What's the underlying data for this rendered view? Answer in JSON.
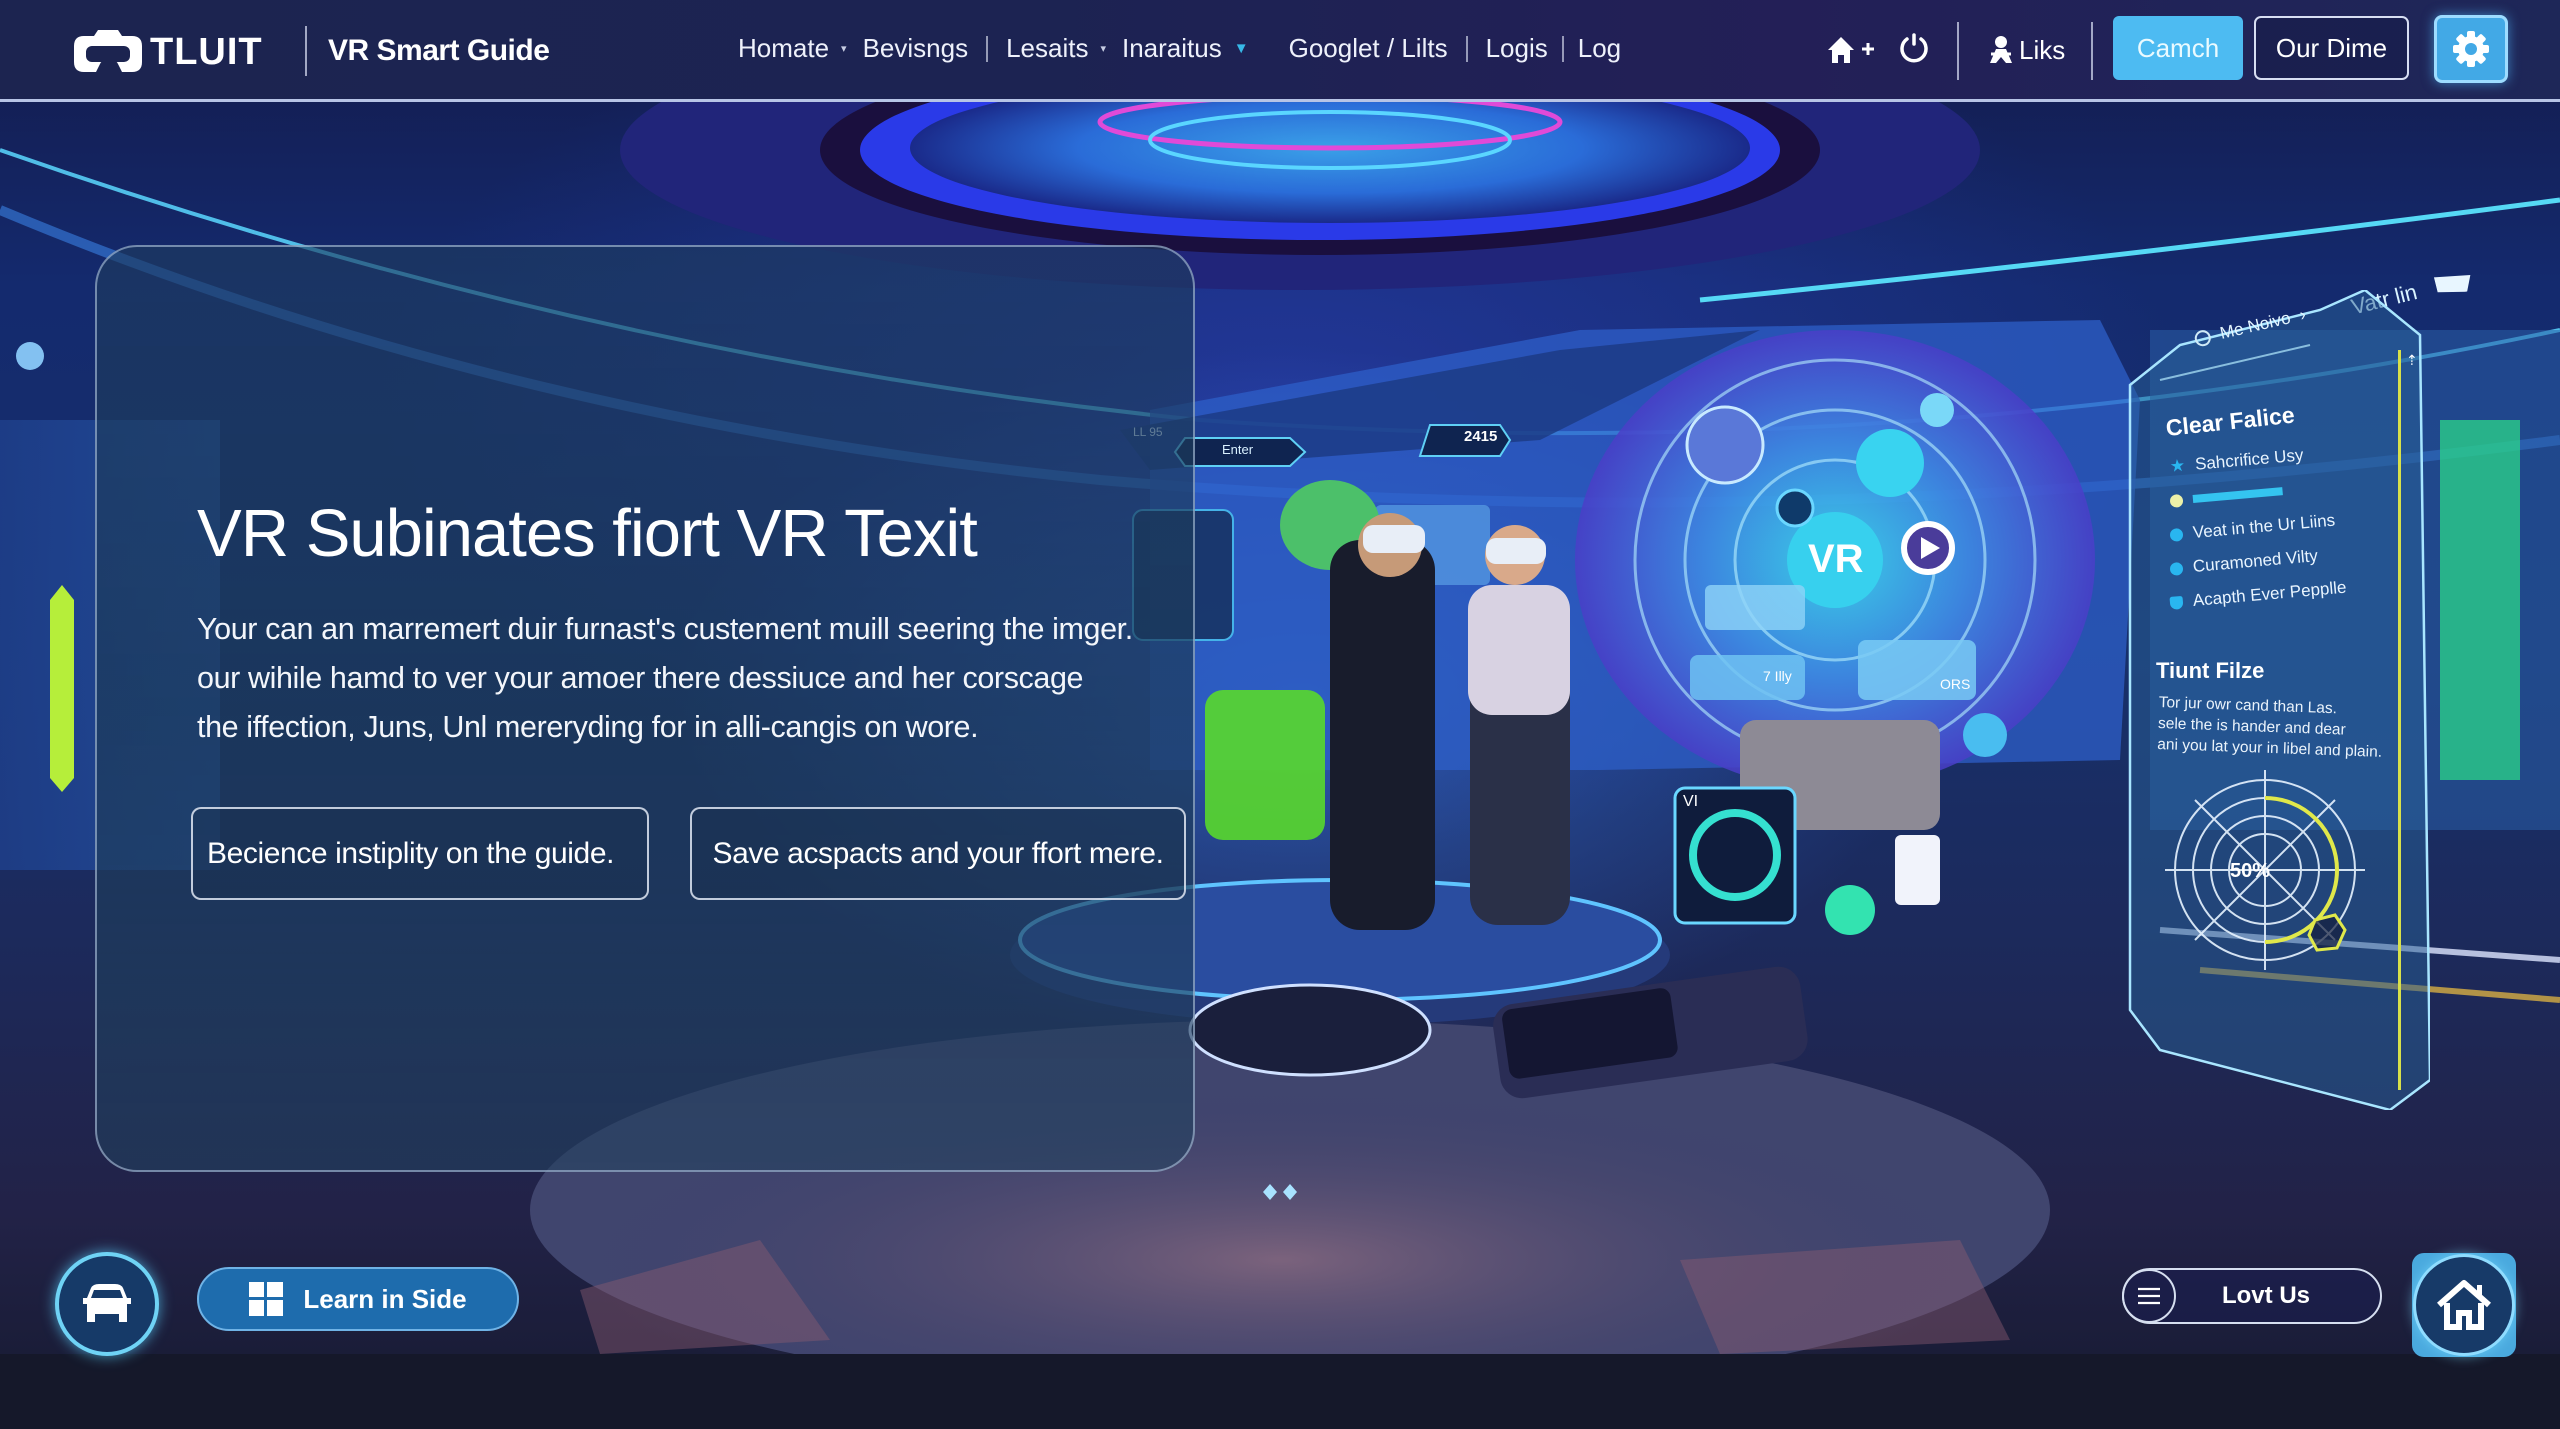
{
  "header": {
    "logo_text": "TLUIT",
    "app_title": "VR Smart Guide",
    "nav": [
      {
        "label": "Homate",
        "has_caret": true
      },
      {
        "label": "Bevisngs",
        "has_caret": false
      },
      {
        "label": "Lesaits",
        "has_caret": true
      },
      {
        "label": "Inaraitus",
        "has_caret": true,
        "caret_accent": true
      },
      {
        "label": "Googlet / Lilts",
        "has_caret": false
      },
      {
        "label": "Logis",
        "has_caret": false
      },
      {
        "label": "Log",
        "has_caret": false
      }
    ],
    "home_add_icon": "home-plus-icon",
    "power_icon": "power-icon",
    "liks_label": "Liks",
    "liks_icon": "person-icon",
    "camch_label": "Camch",
    "our_dime_label": "Our Dime",
    "settings_icon": "gear-icon",
    "colors": {
      "accent": "#4dbbf2",
      "nav_bg": "#1c2450"
    }
  },
  "hero": {
    "title": "VR Subinates fiort VR Texit",
    "body_lines": [
      "Your can an marremert duir furnast's custement muill seering the imger.",
      "our wihile hamd to ver your amoer there dessiuce and her corscage",
      "the iffection, Juns, Unl mereryding for in alli-cangis on wore."
    ],
    "button_1": "Becience instiplity on the guide.",
    "button_2": "Save acspacts and your ffort mere."
  },
  "scene": {
    "hud_tag_1": "Enter",
    "hud_tag_2": "LL 95",
    "score_value": "2415",
    "center_badge": "VR",
    "chip_1": "7 Illy",
    "chip_2": "ORS",
    "device_label": "VI"
  },
  "hud_panel": {
    "header": "Me Noivo",
    "side_label": "Vatr lin",
    "section_title": "Clear Falice",
    "items": [
      {
        "label": "Sahcrifice Usy",
        "bullet": "star"
      },
      {
        "label": "",
        "bullet": "dot-yellow",
        "bar": true
      },
      {
        "label": "Veat in the Ur Liins",
        "bullet": "dot"
      },
      {
        "label": "Curamoned Vilty",
        "bullet": "dot"
      },
      {
        "label": "Acapth Ever Pepplle",
        "bullet": "shield"
      }
    ],
    "section_title_2": "Tiunt Filze",
    "desc_lines": [
      "Tor jur owr cand than Las.",
      "sele the is hander and dear",
      "ani you lat your in libel and plain."
    ],
    "gauge_label": "50%",
    "gauge_value": 0.5
  },
  "footer": {
    "car_icon": "car-icon",
    "learn_label": "Learn in Side",
    "learn_icon": "windows-icon",
    "lovt_label": "Lovt Us",
    "menu_icon": "menu-icon",
    "home_icon": "home-icon"
  }
}
